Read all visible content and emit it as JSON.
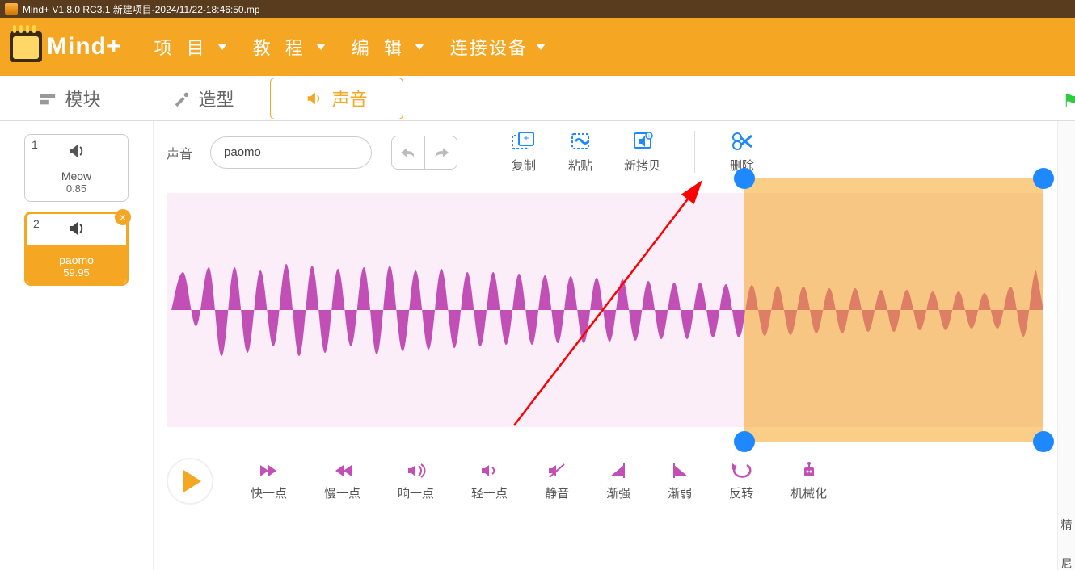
{
  "title": "Mind+ V1.8.0 RC3.1   新建项目-2024/11/22-18:46:50.mp",
  "logo_text": "Mind+",
  "menu": {
    "project": "项 目",
    "tutorial": "教 程",
    "edit": "编 辑",
    "connect": "连接设备"
  },
  "tabs": {
    "blocks": "模块",
    "costumes": "造型",
    "sounds": "声音"
  },
  "sounds_list": [
    {
      "index": "1",
      "name": "Meow",
      "duration": "0.85",
      "selected": false
    },
    {
      "index": "2",
      "name": "paomo",
      "duration": "59.95",
      "selected": true
    }
  ],
  "editor": {
    "label": "声音",
    "name_value": "paomo",
    "tools": {
      "copy": "复制",
      "paste": "粘贴",
      "copy_new": "新拷贝",
      "delete": "删除"
    }
  },
  "controls": {
    "faster": "快一点",
    "slower": "慢一点",
    "louder": "响一点",
    "softer": "轻一点",
    "mute": "静音",
    "fadein": "渐强",
    "fadeout": "渐弱",
    "reverse": "反转",
    "robot": "机械化"
  },
  "right_labels": {
    "a": "精",
    "b": "尼"
  },
  "colors": {
    "accent": "#f5a623",
    "wave": "#c24fb6",
    "selection": "#f5a623",
    "handle": "#1e88ff",
    "arrow": "#ff0000"
  }
}
